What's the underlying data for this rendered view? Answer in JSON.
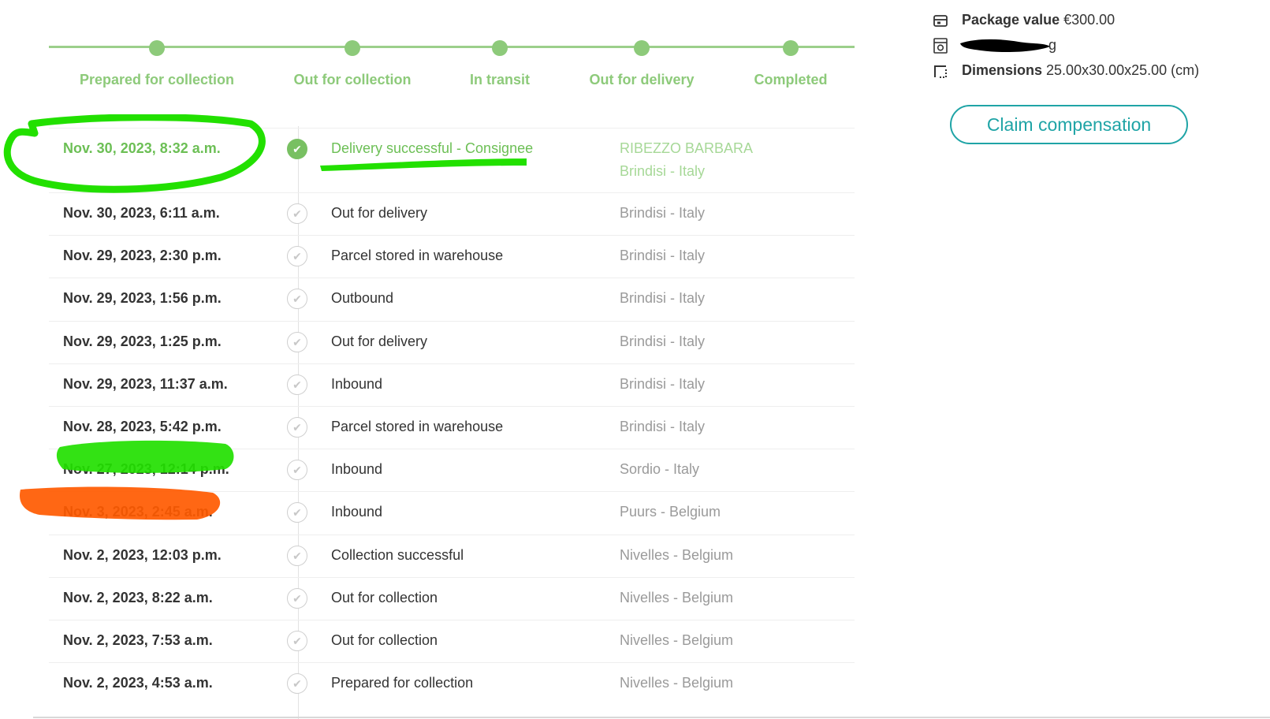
{
  "progress": {
    "steps": [
      {
        "label": "Prepared for collection"
      },
      {
        "label": "Out for collection"
      },
      {
        "label": "In transit"
      },
      {
        "label": "Out for delivery"
      },
      {
        "label": "Completed"
      }
    ]
  },
  "events": [
    {
      "date": "Nov. 30, 2023, 8:32 a.m.",
      "status": "Delivery successful - Consignee",
      "location": "RIBEZZO BARBARA",
      "location2": "Brindisi - Italy"
    },
    {
      "date": "Nov. 30, 2023, 6:11 a.m.",
      "status": "Out for delivery",
      "location": "Brindisi - Italy"
    },
    {
      "date": "Nov. 29, 2023, 2:30 p.m.",
      "status": "Parcel stored in warehouse",
      "location": "Brindisi - Italy"
    },
    {
      "date": "Nov. 29, 2023, 1:56 p.m.",
      "status": "Outbound",
      "location": "Brindisi - Italy"
    },
    {
      "date": "Nov. 29, 2023, 1:25 p.m.",
      "status": "Out for delivery",
      "location": "Brindisi - Italy"
    },
    {
      "date": "Nov. 29, 2023, 11:37 a.m.",
      "status": "Inbound",
      "location": "Brindisi - Italy"
    },
    {
      "date": "Nov. 28, 2023, 5:42 p.m.",
      "status": "Parcel stored in warehouse",
      "location": "Brindisi - Italy"
    },
    {
      "date": "Nov. 27, 2023, 12:14 p.m.",
      "status": "Inbound",
      "location": "Sordio - Italy"
    },
    {
      "date": "Nov. 3, 2023, 2:45 a.m.",
      "status": "Inbound",
      "location": "Puurs - Belgium"
    },
    {
      "date": "Nov. 2, 2023, 12:03 p.m.",
      "status": "Collection successful",
      "location": "Nivelles - Belgium"
    },
    {
      "date": "Nov. 2, 2023, 8:22 a.m.",
      "status": "Out for collection",
      "location": "Nivelles - Belgium"
    },
    {
      "date": "Nov. 2, 2023, 7:53 a.m.",
      "status": "Out for collection",
      "location": "Nivelles - Belgium"
    },
    {
      "date": "Nov. 2, 2023, 4:53 a.m.",
      "status": "Prepared for collection",
      "location": "Nivelles - Belgium"
    }
  ],
  "package": {
    "value_label": "Package value",
    "value": "€300.00",
    "weight_suffix": "g",
    "dimensions_label": "Dimensions",
    "dimensions": "25.00x30.00x25.00 (cm)"
  },
  "claim_button_label": "Claim compensation",
  "icons": {
    "package_value": "box-icon",
    "weight": "scale-icon",
    "dimensions": "dimensions-icon",
    "event_check": "check-circle-icon"
  },
  "colors": {
    "progress_green": "#8dca7a",
    "delivered_green": "#6cbf55",
    "claim_teal": "#1fa4a6",
    "highlight_green": "#22e000",
    "highlight_orange": "#ff5a00",
    "redaction_black": "#000000"
  }
}
